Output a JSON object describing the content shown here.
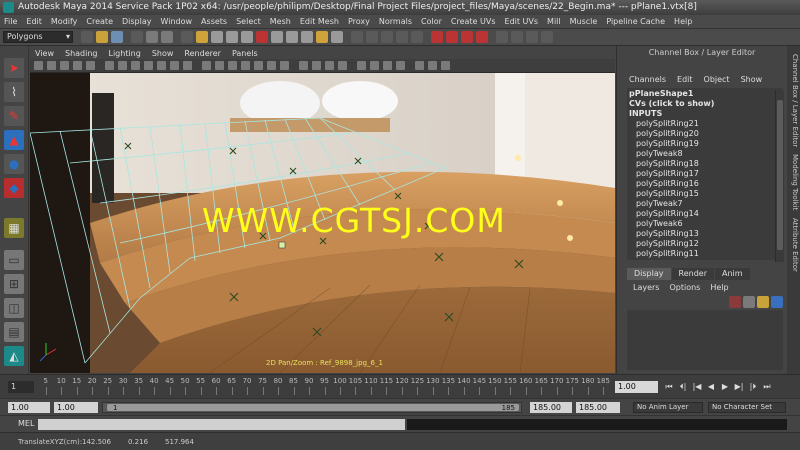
{
  "window": {
    "title": "Autodesk Maya 2014 Service Pack 1P02 x64: /usr/people/philipm/Desktop/Final Project Files/project_files/Maya/scenes/22_Begin.ma*   ---   pPlane1.vtx[8]"
  },
  "menubar": [
    "File",
    "Edit",
    "Modify",
    "Create",
    "Display",
    "Window",
    "Assets",
    "Select",
    "Mesh",
    "Edit Mesh",
    "Proxy",
    "Normals",
    "Color",
    "Create UVs",
    "Edit UVs",
    "Mill",
    "Muscle",
    "Pipeline Cache",
    "Help"
  ],
  "status_line": {
    "menu_set": "Polygons"
  },
  "panel": {
    "menu": [
      "View",
      "Shading",
      "Lighting",
      "Show",
      "Renderer",
      "Panels"
    ],
    "hud_text": "2D Pan/Zoom : Ref_9898_jpg_6_1",
    "watermark": "WWW.CGTSJ.COM"
  },
  "channel_box": {
    "title": "Channel Box / Layer Editor",
    "menu": [
      "Channels",
      "Edit",
      "Object",
      "Show"
    ],
    "shape_name": "pPlaneShape1",
    "cvs_label": "CVs (click to show)",
    "inputs_label": "INPUTS",
    "inputs": [
      "polySplitRing21",
      "polySplitRing20",
      "polySplitRing19",
      "polyTweak8",
      "polySplitRing18",
      "polySplitRing17",
      "polySplitRing16",
      "polySplitRing15",
      "polyTweak7",
      "polySplitRing14",
      "polyTweak6",
      "polySplitRing13",
      "polySplitRing12",
      "polySplitRing11"
    ]
  },
  "layer_editor": {
    "tabs": [
      "Display",
      "Render",
      "Anim"
    ],
    "active_tab": "Display",
    "menu": [
      "Layers",
      "Options",
      "Help"
    ]
  },
  "side_tabs": [
    "Channel Box / Layer Editor",
    "Modeling Toolkit",
    "Attribute Editor"
  ],
  "time_slider": {
    "start_frame": "1",
    "tick_labels": [
      "5",
      "10",
      "15",
      "20",
      "25",
      "30",
      "35",
      "40",
      "45",
      "50",
      "55",
      "60",
      "65",
      "70",
      "75",
      "80",
      "85",
      "90",
      "95",
      "100",
      "105",
      "110",
      "115",
      "120",
      "125",
      "130",
      "135",
      "140",
      "145",
      "150",
      "155",
      "160",
      "165",
      "170",
      "175",
      "180",
      "185"
    ],
    "current_frame": "1.00",
    "playback_buttons": [
      "⏮",
      "⏴|",
      "|◀",
      "◀",
      "▶",
      "▶|",
      "|⏵",
      "⏭"
    ]
  },
  "range_slider": {
    "start_time": "1.00",
    "playback_start": "1.00",
    "range_start_label": "1",
    "range_end_label": "185",
    "playback_end": "185.00",
    "end_time": "185.00",
    "anim_layer": "No Anim Layer",
    "character_set": "No Character Set"
  },
  "command_line": {
    "label": "MEL"
  },
  "help_line": {
    "label": "TranslateXYZ(cm):",
    "x": "142.506",
    "y": "0.216",
    "z": "517.964"
  },
  "colors": {
    "maya_teal": "#1d8a8a",
    "wireframe": "#a8e6e0",
    "vertex": "#2b4a1f",
    "watermark": "#ffff1a"
  }
}
